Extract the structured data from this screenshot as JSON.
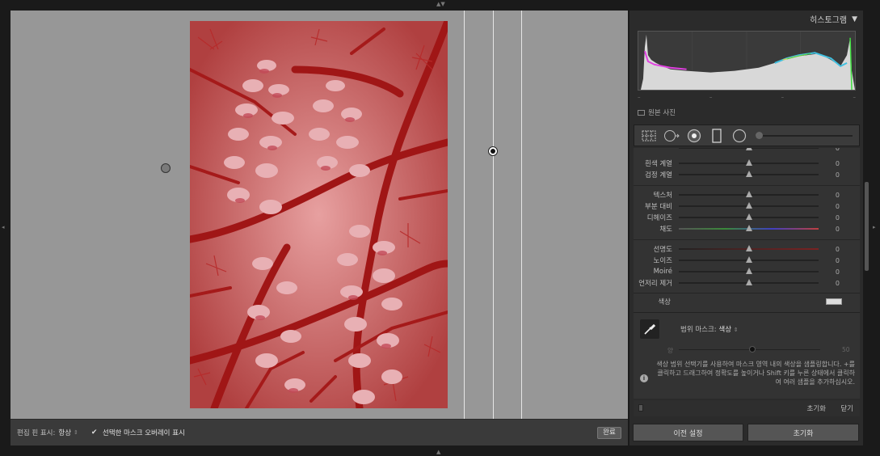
{
  "canvas": {
    "bottom_bar": {
      "pin_display_label": "편집 핀 표시:",
      "pin_display_value": "항상",
      "overlay_checkbox_label": "선택한 마스크 오버레이 표시",
      "overlay_checked": true,
      "done_label": "완료"
    }
  },
  "histogram": {
    "title": "히스토그램",
    "stats": [
      "–",
      "–",
      "–",
      "–"
    ],
    "original_photo_label": "원본 사진"
  },
  "toolbar": {
    "tools": [
      "grid-tool-icon",
      "circle-arrow-tool-icon",
      "target-tool-icon",
      "rectangle-tool-icon",
      "circle-tool-icon"
    ]
  },
  "sliders": {
    "group1": [
      {
        "label": "흰색 계열",
        "value": "0"
      },
      {
        "label": "검정 계열",
        "value": "0"
      }
    ],
    "group2": [
      {
        "label": "텍스처",
        "value": "0"
      },
      {
        "label": "부분 대비",
        "value": "0"
      },
      {
        "label": "디헤이즈",
        "value": "0"
      },
      {
        "label": "채도",
        "value": "0"
      }
    ],
    "group3": [
      {
        "label": "선명도",
        "value": "0"
      },
      {
        "label": "노이즈",
        "value": "0"
      },
      {
        "label": "Moiré",
        "value": "0"
      },
      {
        "label": "언저리 제거",
        "value": "0"
      }
    ],
    "color_label": "색상"
  },
  "mask": {
    "range_mask_label": "범위 마스크:",
    "range_mask_value": "색상",
    "amount_min_label": "양",
    "amount_max_label": "50",
    "info_text": "색상 범위 선택기를 사용하여 마스크 영역 내의 색상을 샘플링합니다. +를 클릭하고 드래그하여 정확도를 높이거나 Shift 키를 누른 상태에서 클릭하여 여러 샘플을 추가하십시오.",
    "reset_label": "초기화",
    "close_label": "닫기"
  },
  "footer": {
    "previous_label": "이전 설정",
    "reset_label": "초기화"
  }
}
